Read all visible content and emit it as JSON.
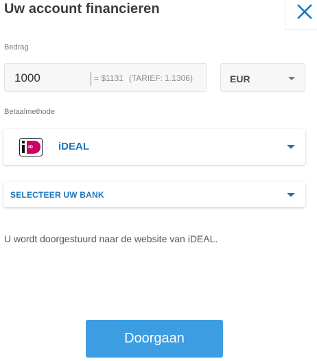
{
  "header": {
    "title": "Uw account financieren",
    "close_icon": "close-icon"
  },
  "amount": {
    "label": "Bedrag",
    "value": "1000",
    "converted": "= $1131",
    "rate": "(TARIEF: 1.1306)"
  },
  "currency": {
    "selected": "EUR"
  },
  "payment_method": {
    "label": "Betaalmethode",
    "selected": "iDEAL",
    "logo_icon": "ideal-logo-icon"
  },
  "bank": {
    "placeholder": "SELECTEER UW BANK"
  },
  "redirect_notice": "U wordt doorgestuurd naar de website van iDEAL.",
  "continue_label": "Doorgaan",
  "colors": {
    "accent": "#1a75bb",
    "button": "#3d9de2",
    "ideal_pink": "#cc0066"
  }
}
